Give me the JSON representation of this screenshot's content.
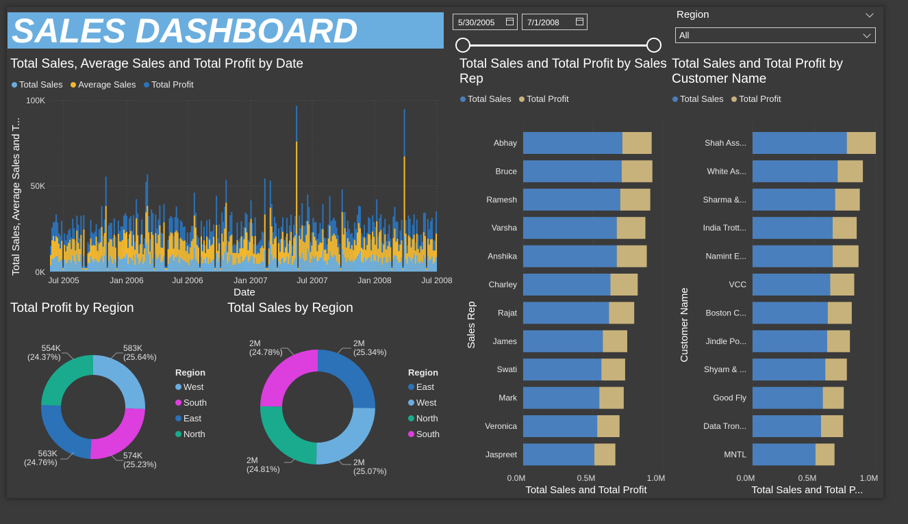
{
  "title": "SALES DASHBOARD",
  "date_filter": {
    "start": "5/30/2005",
    "end": "7/1/2008"
  },
  "region_filter": {
    "label": "Region",
    "selected": "All"
  },
  "colors": {
    "total_sales": "#6aaee0",
    "average_sales": "#f5b72a",
    "total_profit": "#2b72b8",
    "bar_sales": "#4a7fbd",
    "bar_profit": "#c8b27b",
    "west": "#6aaee0",
    "south": "#dd3ede",
    "east": "#2b72b8",
    "north": "#1aab8e"
  },
  "line_chart": {
    "title": "Total Sales, Average Sales and Total Profit by Date",
    "legend": [
      "Total Sales",
      "Average Sales",
      "Total Profit"
    ],
    "ylabel": "Total Sales, Average Sales and T...",
    "xlabel": "Date",
    "y_ticks": [
      "100K",
      "50K",
      "0K"
    ],
    "x_ticks": [
      "Jul 2005",
      "Jan 2006",
      "Jul 2006",
      "Jan 2007",
      "Jul 2007",
      "Jan 2008",
      "Jul 2008"
    ]
  },
  "profit_region": {
    "title": "Total Profit by Region",
    "legend_title": "Region",
    "legend": [
      "West",
      "South",
      "East",
      "North"
    ],
    "labels": [
      {
        "value": "583K",
        "pct": "(25.64%)"
      },
      {
        "value": "574K",
        "pct": "(25.23%)"
      },
      {
        "value": "563K",
        "pct": "(24.76%)"
      },
      {
        "value": "554K",
        "pct": "(24.37%)"
      }
    ]
  },
  "sales_region": {
    "title": "Total Sales by Region",
    "legend_title": "Region",
    "legend": [
      "East",
      "West",
      "North",
      "South"
    ],
    "labels": [
      {
        "value": "2M",
        "pct": "(25.34%)"
      },
      {
        "value": "2M",
        "pct": "(25.07%)"
      },
      {
        "value": "2M",
        "pct": "(24.81%)"
      },
      {
        "value": "2M",
        "pct": "(24.78%)"
      }
    ]
  },
  "rep_chart": {
    "title": "Total Sales and Total Profit by Sales Rep",
    "legend": [
      "Total Sales",
      "Total Profit"
    ],
    "ylabel": "Sales Rep",
    "xlabel": "Total Sales and Total Profit",
    "x_ticks": [
      "0.0M",
      "0.5M",
      "1.0M"
    ]
  },
  "cust_chart": {
    "title": "Total Sales and Total Profit by Customer Name",
    "legend": [
      "Total Sales",
      "Total Profit"
    ],
    "ylabel": "Customer Name",
    "xlabel": "Total Sales and Total P...",
    "x_ticks": [
      "0.0M",
      "0.5M",
      "1.0M"
    ]
  },
  "chart_data": [
    {
      "type": "area",
      "title": "Total Sales, Average Sales and Total Profit by Date",
      "x_range": [
        "2005-05-30",
        "2008-07-01"
      ],
      "ylim": [
        0,
        100000
      ],
      "series": [
        {
          "name": "Total Sales",
          "typical_range": [
            15000,
            50000
          ],
          "peak": 97000
        },
        {
          "name": "Average Sales",
          "typical_range": [
            10000,
            30000
          ],
          "peak": 76000
        },
        {
          "name": "Total Profit",
          "typical_range": [
            5000,
            15000
          ]
        }
      ]
    },
    {
      "type": "pie",
      "title": "Total Profit by Region",
      "categories": [
        "West",
        "South",
        "East",
        "North"
      ],
      "values": [
        583000,
        574000,
        563000,
        554000
      ],
      "percent": [
        25.64,
        25.23,
        24.76,
        24.37
      ]
    },
    {
      "type": "pie",
      "title": "Total Sales by Region",
      "categories": [
        "East",
        "West",
        "North",
        "South"
      ],
      "values": [
        2000000,
        2000000,
        2000000,
        2000000
      ],
      "percent": [
        25.34,
        25.07,
        24.81,
        24.78
      ]
    },
    {
      "type": "bar",
      "title": "Total Sales and Total Profit by Sales Rep",
      "categories": [
        "Abhay",
        "Bruce",
        "Ramesh",
        "Varsha",
        "Anshika",
        "Charley",
        "Rajat",
        "James",
        "Swati",
        "Mark",
        "Veronica",
        "Jaspreet"
      ],
      "series": [
        {
          "name": "Total Sales",
          "values": [
            710000,
            705000,
            695000,
            670000,
            670000,
            625000,
            615000,
            570000,
            560000,
            545000,
            530000,
            510000
          ]
        },
        {
          "name": "Total Profit",
          "values": [
            210000,
            220000,
            215000,
            205000,
            215000,
            195000,
            180000,
            175000,
            170000,
            175000,
            160000,
            150000
          ]
        }
      ],
      "xlim": [
        0,
        1000000
      ]
    },
    {
      "type": "bar",
      "title": "Total Sales and Total Profit by Customer Name",
      "categories": [
        "Shah Ass...",
        "White As...",
        "Sharma &...",
        "India Trott...",
        "Namint E...",
        "VCC",
        "Boston C...",
        "Jindle Po...",
        "Shyam & ...",
        "Good Fly",
        "Data Tron...",
        "MNTL"
      ],
      "series": [
        {
          "name": "Total Sales",
          "values": [
            765000,
            690000,
            670000,
            650000,
            650000,
            630000,
            610000,
            605000,
            590000,
            570000,
            555000,
            510000
          ]
        },
        {
          "name": "Total Profit",
          "values": [
            235000,
            205000,
            200000,
            195000,
            210000,
            195000,
            195000,
            185000,
            175000,
            170000,
            180000,
            155000
          ]
        }
      ],
      "xlim": [
        0,
        1000000
      ]
    }
  ]
}
